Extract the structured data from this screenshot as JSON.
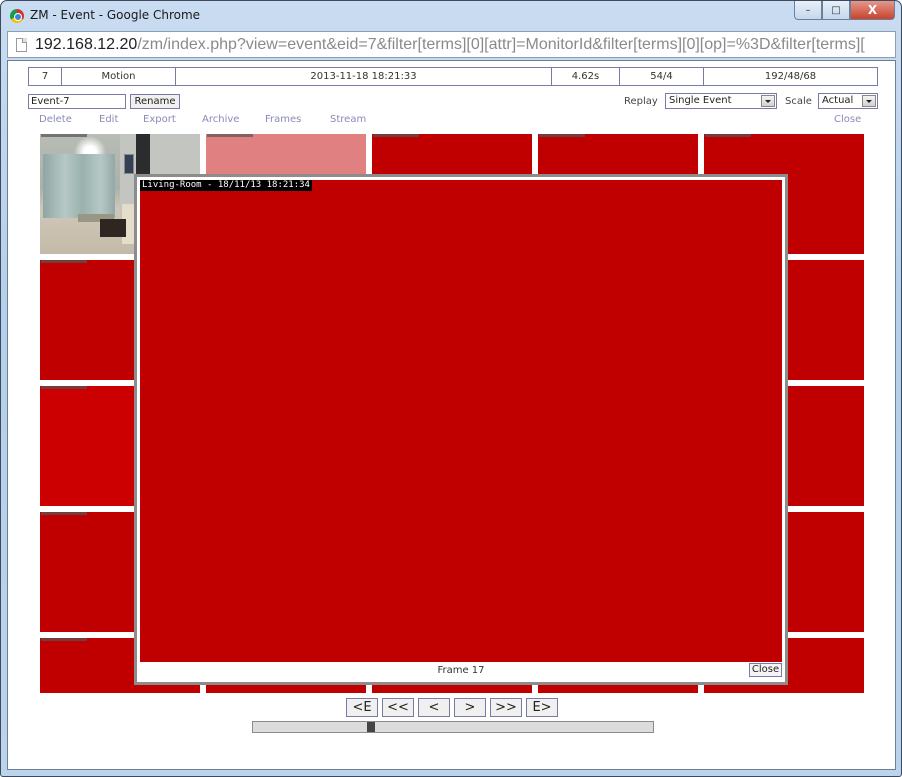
{
  "window": {
    "title": "ZM - Event - Google Chrome",
    "controls": {
      "minimize": "–",
      "maximize": "□",
      "close": "X"
    }
  },
  "address_bar": {
    "host": "192.168.12.20",
    "path": "/zm/index.php?view=event&eid=7&filter[terms][0][attr]=MonitorId&filter[terms][0][op]=%3D&filter[terms]["
  },
  "event_info": {
    "id": "7",
    "cause": "Motion",
    "start_time": "2013-11-18 18:21:33",
    "length": "4.62s",
    "frames": "54/4",
    "scores": "192/48/68"
  },
  "rename": {
    "name_value": "Event-7",
    "button_label": "Rename"
  },
  "replay": {
    "label": "Replay",
    "selected": "Single Event"
  },
  "scale": {
    "label": "Scale",
    "selected": "Actual"
  },
  "menu": {
    "delete": "Delete",
    "edit": "Edit",
    "export": "Export",
    "archive": "Archive",
    "frames": "Frames",
    "stream": "Stream",
    "close": "Close"
  },
  "colors": {
    "alarm_frame": "#c00000",
    "selected_frame": "#e08080",
    "link": "#8a8ab8",
    "border": "#7a7aa8"
  },
  "overlay": {
    "timestamp": "Living-Room - 18/11/13 18:21:34",
    "frame_label": "Frame 17",
    "close_label": "Close"
  },
  "navigation": {
    "first_event": "<E",
    "fast_rewind": "<<",
    "prev": "<",
    "next": ">",
    "fast_forward": ">>",
    "last_event": "E>"
  },
  "progress": {
    "position_fraction": 0.29
  }
}
